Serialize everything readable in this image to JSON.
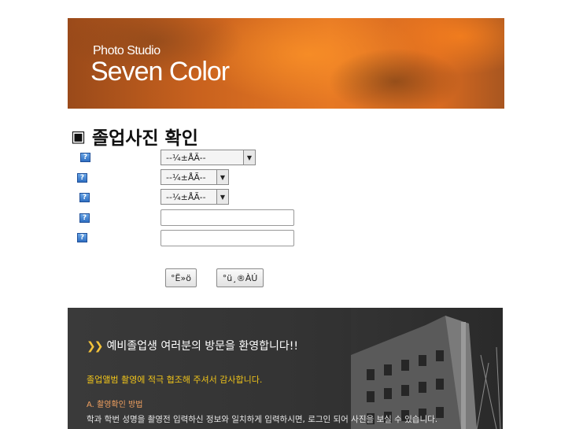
{
  "banner": {
    "studio_label": "Photo Studio",
    "brand_name": "Seven Color"
  },
  "heading": {
    "marker": "▣",
    "title": "졸업사진 확인"
  },
  "form": {
    "help_icon_glyph": "?",
    "selects": [
      {
        "value": "--¼±ÅÃ--"
      },
      {
        "value": "--¼±ÅÃ--"
      },
      {
        "value": "--¼±ÅÃ--"
      }
    ],
    "inputs": [
      {
        "value": ""
      },
      {
        "value": ""
      }
    ],
    "search_label": "°Ë»ö",
    "list_label": "°ü¸®ÀÚ"
  },
  "footer": {
    "chevrons": "❯❯",
    "welcome": "예비졸업생 여러분의 방문을 환영합니다!!",
    "thanks": "졸업앨범 촬영에 적극 협조해 주셔서 감사합니다.",
    "method": "A. 촬영확인 방법",
    "description": "학과 학번 성명을 촬영전 입력하신 정보와 일치하게 입력하시면, 로그인 되어 사진을 보실 수 있습니다."
  },
  "colors": {
    "banner_orange": "#e67824",
    "footer_bg": "#333333",
    "thanks_yellow": "#f0c41a",
    "method_orange": "#f0a060",
    "help_blue": "#2f6fc1"
  }
}
